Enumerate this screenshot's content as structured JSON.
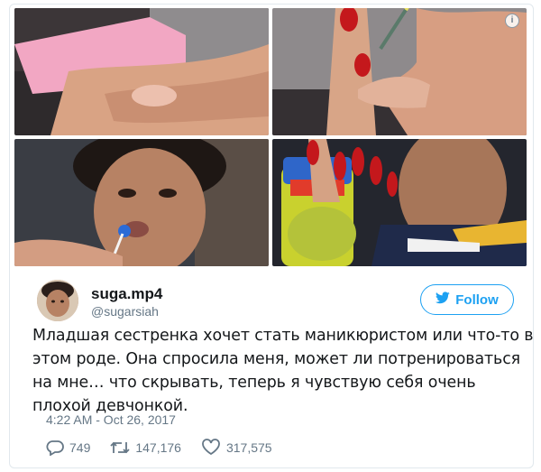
{
  "tweet": {
    "display_name": "suga.mp4",
    "handle": "@sugarsiah",
    "follow_label": "Follow",
    "text": "Младшая сестренка хочет стать маникюристом или что-то в этом роде. Она спросила меня, может ли потренироваться на мне… что скрывать, теперь я чувствую себя очень плохой девчонкой.",
    "timestamp": "4:22 AM - Oct 26, 2017",
    "replies": "749",
    "retweets": "147,176",
    "likes": "317,575",
    "info_glyph": "i",
    "accent_color": "#1da1f2",
    "icons": [
      "twitter-bird-icon",
      "reply-icon",
      "retweet-icon",
      "like-heart-icon",
      "info-icon"
    ]
  },
  "photos": [
    {
      "name": "photo-nail-buffing",
      "color": "#d7a58c"
    },
    {
      "name": "photo-nail-painting",
      "color": "#c98f74"
    },
    {
      "name": "photo-lollipop-selfie",
      "color": "#7a5a48"
    },
    {
      "name": "photo-red-nails-selfie",
      "color": "#8a6a52"
    }
  ]
}
